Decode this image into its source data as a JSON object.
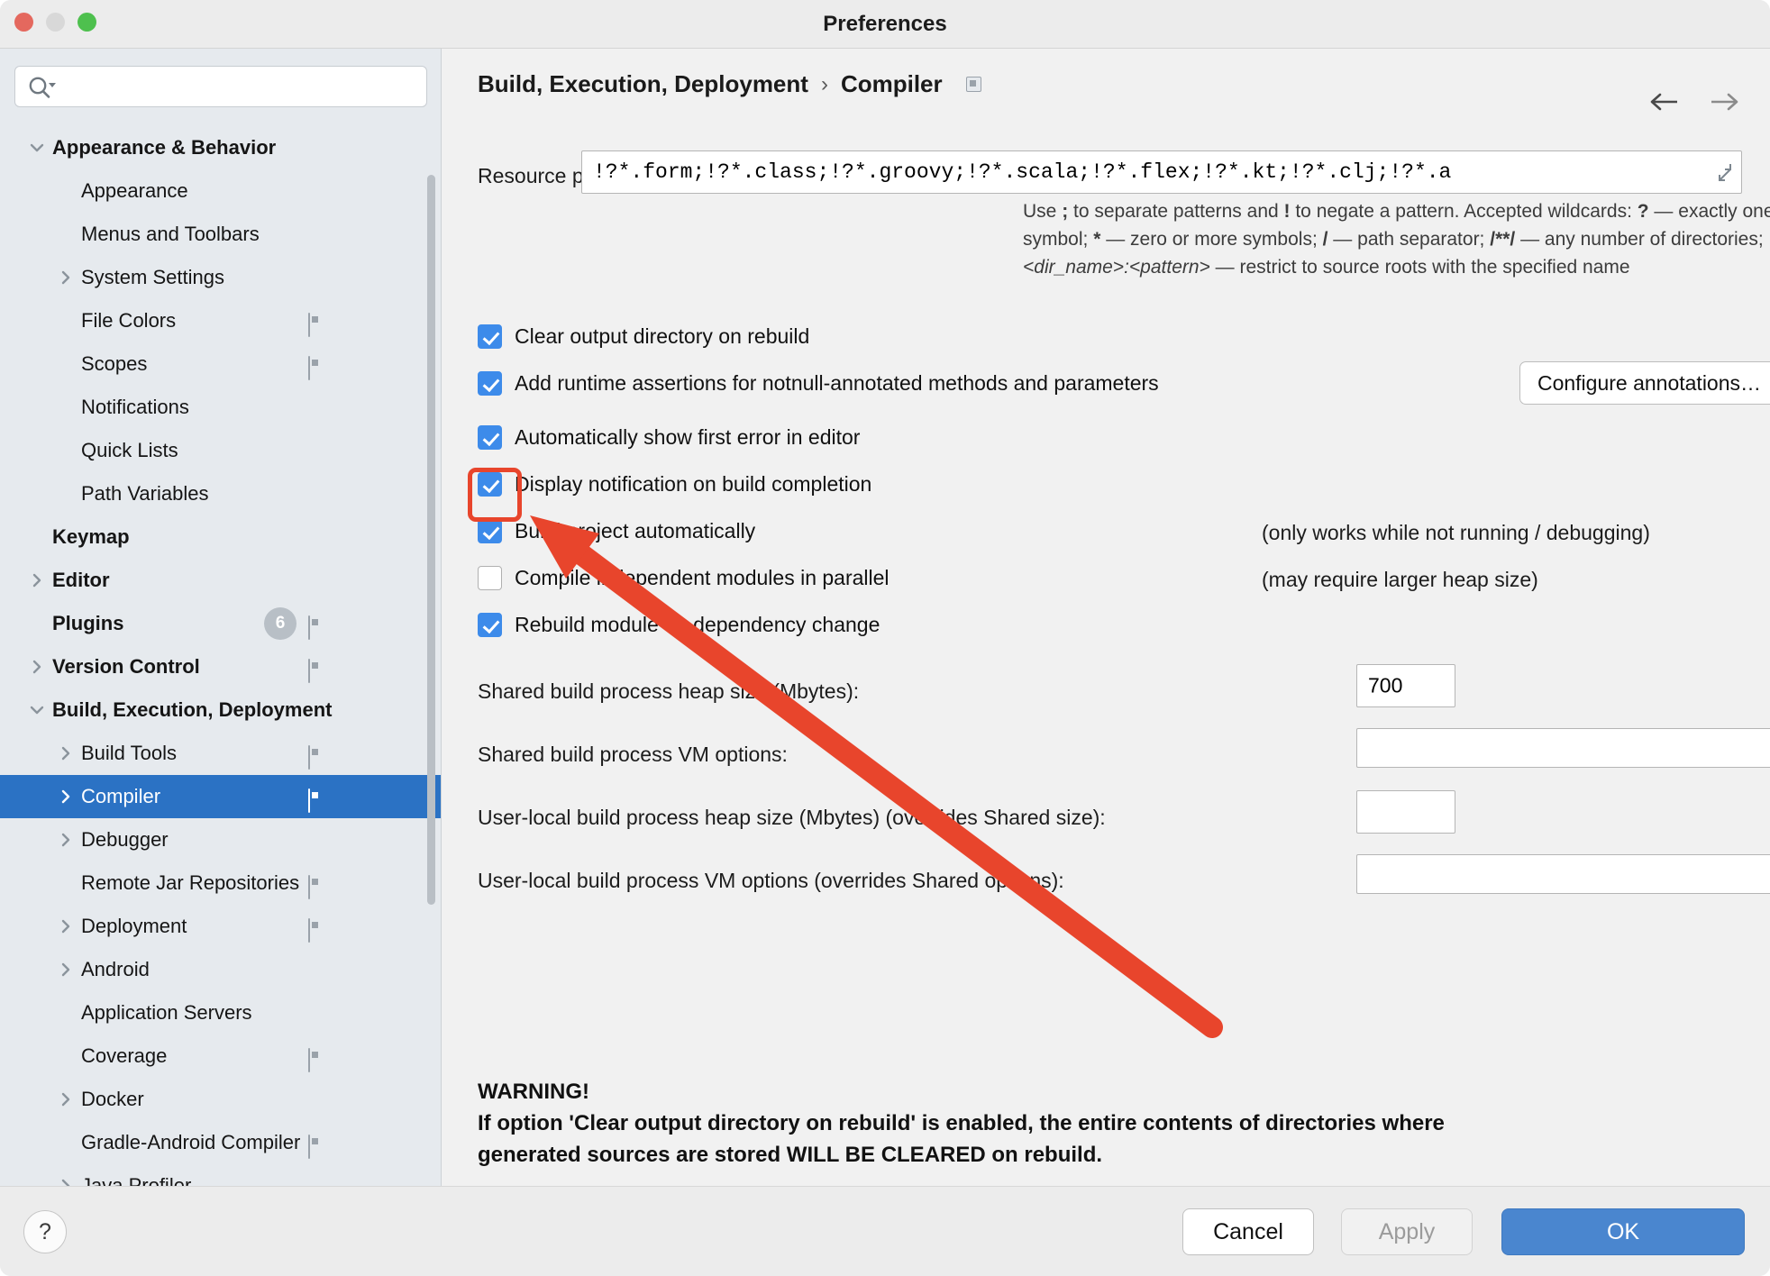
{
  "window": {
    "title": "Preferences",
    "traffic_lights": [
      "close",
      "minimize",
      "zoom"
    ]
  },
  "sidebar": {
    "search": {
      "value": "",
      "placeholder": "",
      "icon": "search-icon"
    },
    "items": [
      {
        "label": "Appearance & Behavior",
        "level": 0,
        "bold": true,
        "twisty": "down",
        "cfg": false,
        "selected": false
      },
      {
        "label": "Appearance",
        "level": 1,
        "bold": false,
        "twisty": "none",
        "cfg": false,
        "selected": false
      },
      {
        "label": "Menus and Toolbars",
        "level": 1,
        "bold": false,
        "twisty": "none",
        "cfg": false,
        "selected": false
      },
      {
        "label": "System Settings",
        "level": 1,
        "bold": false,
        "twisty": "right",
        "cfg": false,
        "selected": false
      },
      {
        "label": "File Colors",
        "level": 1,
        "bold": false,
        "twisty": "none",
        "cfg": true,
        "selected": false
      },
      {
        "label": "Scopes",
        "level": 1,
        "bold": false,
        "twisty": "none",
        "cfg": true,
        "selected": false
      },
      {
        "label": "Notifications",
        "level": 1,
        "bold": false,
        "twisty": "none",
        "cfg": false,
        "selected": false
      },
      {
        "label": "Quick Lists",
        "level": 1,
        "bold": false,
        "twisty": "none",
        "cfg": false,
        "selected": false
      },
      {
        "label": "Path Variables",
        "level": 1,
        "bold": false,
        "twisty": "none",
        "cfg": false,
        "selected": false
      },
      {
        "label": "Keymap",
        "level": 0,
        "bold": true,
        "twisty": "none",
        "cfg": false,
        "selected": false
      },
      {
        "label": "Editor",
        "level": 0,
        "bold": true,
        "twisty": "right",
        "cfg": false,
        "selected": false
      },
      {
        "label": "Plugins",
        "level": 0,
        "bold": true,
        "twisty": "none",
        "cfg": true,
        "selected": false,
        "badge": "6"
      },
      {
        "label": "Version Control",
        "level": 0,
        "bold": true,
        "twisty": "right",
        "cfg": true,
        "selected": false
      },
      {
        "label": "Build, Execution, Deployment",
        "level": 0,
        "bold": true,
        "twisty": "down",
        "cfg": false,
        "selected": false
      },
      {
        "label": "Build Tools",
        "level": 1,
        "bold": false,
        "twisty": "right",
        "cfg": true,
        "selected": false
      },
      {
        "label": "Compiler",
        "level": 1,
        "bold": false,
        "twisty": "right",
        "cfg": true,
        "selected": true
      },
      {
        "label": "Debugger",
        "level": 1,
        "bold": false,
        "twisty": "right",
        "cfg": false,
        "selected": false
      },
      {
        "label": "Remote Jar Repositories",
        "level": 1,
        "bold": false,
        "twisty": "none",
        "cfg": true,
        "selected": false
      },
      {
        "label": "Deployment",
        "level": 1,
        "bold": false,
        "twisty": "right",
        "cfg": true,
        "selected": false
      },
      {
        "label": "Android",
        "level": 1,
        "bold": false,
        "twisty": "right",
        "cfg": false,
        "selected": false
      },
      {
        "label": "Application Servers",
        "level": 1,
        "bold": false,
        "twisty": "none",
        "cfg": false,
        "selected": false
      },
      {
        "label": "Coverage",
        "level": 1,
        "bold": false,
        "twisty": "none",
        "cfg": true,
        "selected": false
      },
      {
        "label": "Docker",
        "level": 1,
        "bold": false,
        "twisty": "right",
        "cfg": false,
        "selected": false
      },
      {
        "label": "Gradle-Android Compiler",
        "level": 1,
        "bold": false,
        "twisty": "none",
        "cfg": true,
        "selected": false
      },
      {
        "label": "Java Profiler",
        "level": 1,
        "bold": false,
        "twisty": "right",
        "cfg": false,
        "selected": false
      }
    ]
  },
  "main": {
    "breadcrumb": {
      "parent": "Build, Execution, Deployment",
      "separator": "›",
      "current": "Compiler",
      "config_icon": "project-settings-icon"
    },
    "nav": {
      "back_icon": "arrow-left-icon",
      "forward_icon": "arrow-right-icon"
    },
    "resource_patterns": {
      "label": "Resource patterns:",
      "value": "!?*.form;!?*.class;!?*.groovy;!?*.scala;!?*.flex;!?*.kt;!?*.clj;!?*.a",
      "expand_icon": "expand-icon"
    },
    "hint": {
      "line1_a": "Use ",
      "line1_semi": ";",
      "line1_b": " to separate patterns and ",
      "line1_bang": "!",
      "line1_c": " to negate a pattern. Accepted wildcards: ",
      "line1_q": "?",
      "line1_d": " — exactly one symbol; ",
      "line1_star": "*",
      "line1_e": " — zero or",
      "line2_a": "more symbols; ",
      "line2_slash": "/",
      "line2_b": " — path separator; ",
      "line2_globstar": "/**/",
      "line2_c": " — any number of directories; ",
      "line2_dir": "<dir_name>:<pattern>",
      "line2_d": " — restrict to",
      "line3": "source roots with the specified name"
    },
    "checkboxes": [
      {
        "label": "Clear output directory on rebuild",
        "checked": true,
        "note": ""
      },
      {
        "label": "Add runtime assertions for notnull-annotated methods and parameters",
        "checked": true,
        "note": ""
      },
      {
        "label": "Automatically show first error in editor",
        "checked": true,
        "note": ""
      },
      {
        "label": "Display notification on build completion",
        "checked": true,
        "note": ""
      },
      {
        "label": "Build project automatically",
        "checked": true,
        "note": "(only works while not running / debugging)"
      },
      {
        "label": "Compile independent modules in parallel",
        "checked": false,
        "note": "(may require larger heap size)"
      },
      {
        "label": "Rebuild module on dependency change",
        "checked": true,
        "note": ""
      }
    ],
    "configure_annotations_button": "Configure annotations…",
    "fields": [
      {
        "label": "Shared build process heap size (Mbytes):",
        "value": "700",
        "expandable": false
      },
      {
        "label": "Shared build process VM options:",
        "value": "",
        "expandable": true
      },
      {
        "label": "User-local build process heap size (Mbytes) (overrides Shared size):",
        "value": "",
        "expandable": false
      },
      {
        "label": "User-local build process VM options (overrides Shared options):",
        "value": "",
        "expandable": true
      }
    ],
    "warning": {
      "title": "WARNING!",
      "line1": "If option 'Clear output directory on rebuild' is enabled, the entire contents of directories where",
      "line2": "generated sources are stored WILL BE CLEARED on rebuild."
    },
    "annotation": {
      "highlight_target": "build-project-automatically-checkbox",
      "arrow_color": "#e8452c",
      "highlight_color": "#e8452c"
    }
  },
  "footer": {
    "help_label": "?",
    "cancel_label": "Cancel",
    "apply_label": "Apply",
    "ok_label": "OK"
  }
}
